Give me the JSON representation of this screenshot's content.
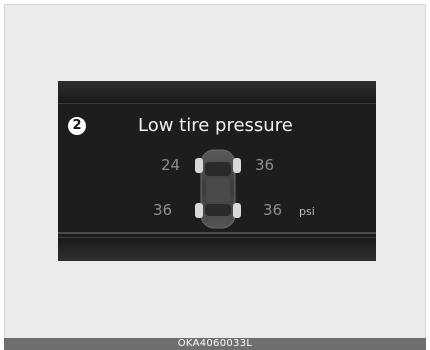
{
  "display": {
    "step_number": "2",
    "title": "Low tire pressure",
    "tires": {
      "front_left": "24",
      "front_right": "36",
      "rear_left": "36",
      "rear_right": "36"
    },
    "unit": "psi",
    "low_tire": "front_left",
    "colors": {
      "background": "#1d1d1d",
      "title": "#f2f2f2",
      "value": "#8e8e8e",
      "tire": "#d9d9d9"
    }
  },
  "footer": {
    "code": "OKA4060033L"
  }
}
